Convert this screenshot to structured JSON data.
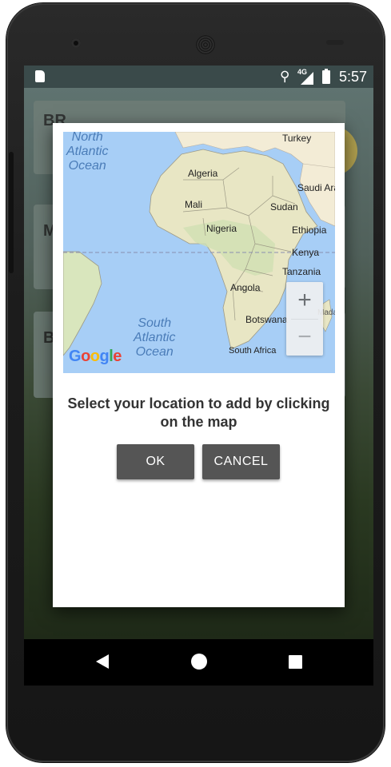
{
  "status_bar": {
    "network": "4G",
    "time": "5:57"
  },
  "background": {
    "card_titles": [
      "BR",
      "M",
      "B"
    ]
  },
  "dialog": {
    "map": {
      "ocean_labels": {
        "north_atlantic": "North\nAtlantic\nOcean",
        "south_atlantic": "South\nAtlantic\nOcean"
      },
      "country_labels": [
        "Turkey",
        "Algeria",
        "Saudi Ara",
        "Mali",
        "Sudan",
        "Nigeria",
        "Ethiopia",
        "Kenya",
        "Tanzania",
        "Angola",
        "Botswana",
        "Madaga",
        "South Africa"
      ],
      "zoom_in": "+",
      "zoom_out": "−",
      "attribution": "Google"
    },
    "message": "Select your location to add by clicking on the map",
    "ok_label": "OK",
    "cancel_label": "CANCEL"
  },
  "navigation": {
    "back": "back-icon",
    "home": "home-icon",
    "recents": "recents-icon"
  },
  "colors": {
    "button": "#555555",
    "ocean": "#a7cef6",
    "land": "#f3ecd6",
    "status_bar": "#3a4a4a"
  }
}
